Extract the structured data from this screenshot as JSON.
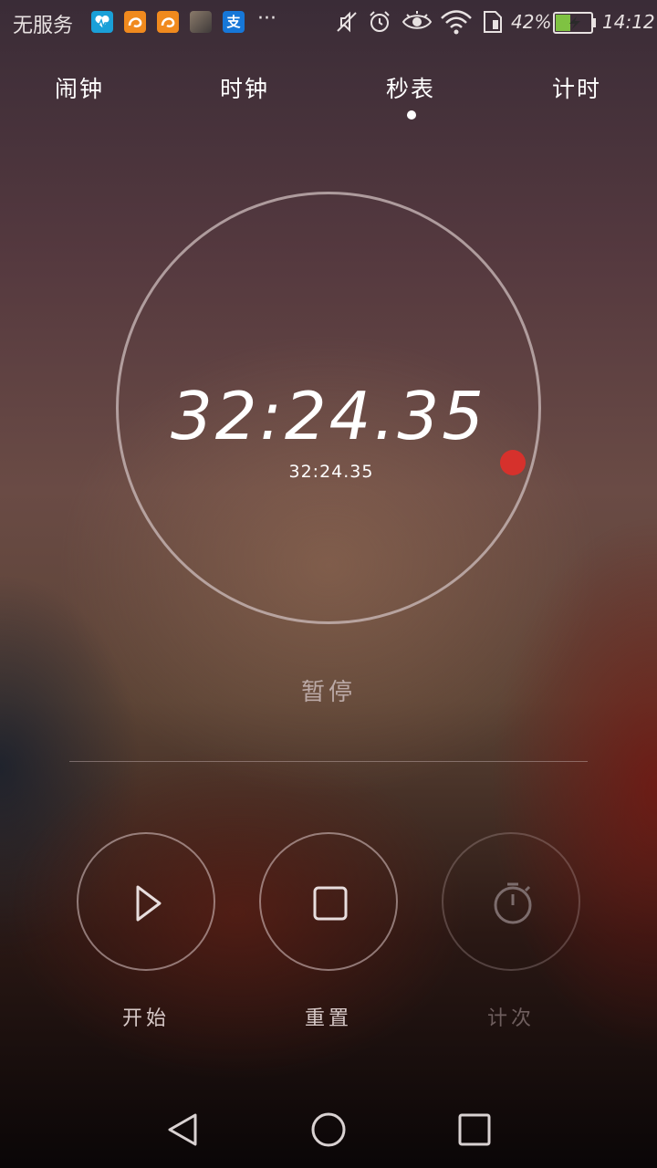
{
  "status_bar": {
    "carrier": "无服务",
    "overflow": "···",
    "alipay_glyph": "支",
    "battery_percent": "42%",
    "battery_level": 0.42,
    "time": "14:12",
    "icons": [
      "health-app-icon",
      "uc-browser-icon",
      "uc-browser-icon",
      "photo-app-icon",
      "alipay-icon",
      "mute-icon",
      "alarm-icon",
      "eye-icon",
      "wifi-icon",
      "sim-icon",
      "battery-icon"
    ]
  },
  "tabs": [
    {
      "label": "闹钟"
    },
    {
      "label": "时钟"
    },
    {
      "label": "秒表",
      "active": true
    },
    {
      "label": "计时"
    }
  ],
  "stopwatch": {
    "main_time": "32:24.35",
    "sub_time": "32:24.35",
    "status": "暂停"
  },
  "controls": {
    "start": {
      "label": "开始",
      "icon": "play-icon"
    },
    "reset": {
      "label": "重置",
      "icon": "stop-icon"
    },
    "lap": {
      "label": "计次",
      "icon": "stopwatch-icon",
      "enabled": false
    }
  },
  "navbar": {
    "icons": [
      "back-icon",
      "home-icon",
      "recents-icon"
    ]
  },
  "colors": {
    "accent_dot": "#d6312c",
    "battery_fill": "#7fc242"
  }
}
